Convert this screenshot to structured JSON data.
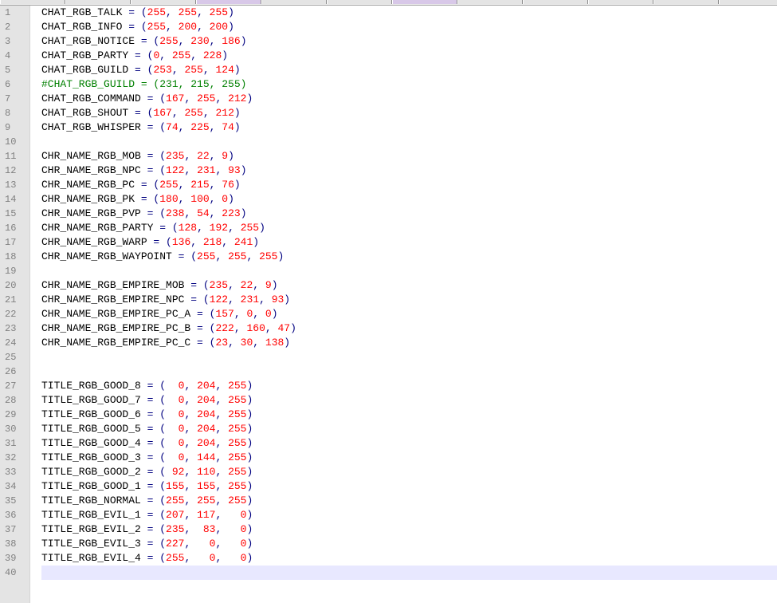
{
  "editor": {
    "colors": {
      "text": "#000000",
      "operator": "#000080",
      "number": "#ff0000",
      "comment": "#008000",
      "current_line": "#e8e8ff",
      "gutter": "#e4e4e4"
    },
    "current_line": 40,
    "lines": [
      {
        "n": "1",
        "kind": "assign",
        "name": "CHAT_RGB_TALK",
        "pad": "",
        "values": [
          "255",
          "255",
          "255"
        ]
      },
      {
        "n": "2",
        "kind": "assign",
        "name": "CHAT_RGB_INFO",
        "pad": "",
        "values": [
          "255",
          "200",
          "200"
        ]
      },
      {
        "n": "3",
        "kind": "assign",
        "name": "CHAT_RGB_NOTICE",
        "pad": "",
        "values": [
          "255",
          "230",
          "186"
        ]
      },
      {
        "n": "4",
        "kind": "assign",
        "name": "CHAT_RGB_PARTY",
        "pad": "",
        "values": [
          "0",
          "255",
          "228"
        ]
      },
      {
        "n": "5",
        "kind": "assign",
        "name": "CHAT_RGB_GUILD",
        "pad": "",
        "values": [
          "253",
          "255",
          "124"
        ]
      },
      {
        "n": "6",
        "kind": "comment",
        "text": "#CHAT_RGB_GUILD = (231, 215, 255)"
      },
      {
        "n": "7",
        "kind": "assign",
        "name": "CHAT_RGB_COMMAND",
        "pad": "",
        "values": [
          "167",
          "255",
          "212"
        ]
      },
      {
        "n": "8",
        "kind": "assign",
        "name": "CHAT_RGB_SHOUT",
        "pad": "",
        "values": [
          "167",
          "255",
          "212"
        ]
      },
      {
        "n": "9",
        "kind": "assign",
        "name": "CHAT_RGB_WHISPER",
        "pad": "",
        "values": [
          "74",
          "225",
          "74"
        ]
      },
      {
        "n": "10",
        "kind": "empty"
      },
      {
        "n": "11",
        "kind": "assign",
        "name": "CHR_NAME_RGB_MOB",
        "pad": "",
        "values": [
          "235",
          "22",
          "9"
        ]
      },
      {
        "n": "12",
        "kind": "assign",
        "name": "CHR_NAME_RGB_NPC",
        "pad": "",
        "values": [
          "122",
          "231",
          "93"
        ]
      },
      {
        "n": "13",
        "kind": "assign",
        "name": "CHR_NAME_RGB_PC",
        "pad": "",
        "values": [
          "255",
          "215",
          "76"
        ]
      },
      {
        "n": "14",
        "kind": "assign",
        "name": "CHR_NAME_RGB_PK",
        "pad": "",
        "values": [
          "180",
          "100",
          "0"
        ]
      },
      {
        "n": "15",
        "kind": "assign",
        "name": "CHR_NAME_RGB_PVP",
        "pad": "",
        "values": [
          "238",
          "54",
          "223"
        ]
      },
      {
        "n": "16",
        "kind": "assign",
        "name": "CHR_NAME_RGB_PARTY",
        "pad": "",
        "values": [
          "128",
          "192",
          "255"
        ]
      },
      {
        "n": "17",
        "kind": "assign",
        "name": "CHR_NAME_RGB_WARP",
        "pad": "",
        "values": [
          "136",
          "218",
          "241"
        ]
      },
      {
        "n": "18",
        "kind": "assign",
        "name": "CHR_NAME_RGB_WAYPOINT",
        "pad": "",
        "values": [
          "255",
          "255",
          "255"
        ]
      },
      {
        "n": "19",
        "kind": "empty"
      },
      {
        "n": "20",
        "kind": "assign",
        "name": "CHR_NAME_RGB_EMPIRE_MOB",
        "pad": "",
        "values": [
          "235",
          "22",
          "9"
        ]
      },
      {
        "n": "21",
        "kind": "assign",
        "name": "CHR_NAME_RGB_EMPIRE_NPC",
        "pad": "",
        "values": [
          "122",
          "231",
          "93"
        ]
      },
      {
        "n": "22",
        "kind": "assign",
        "name": "CHR_NAME_RGB_EMPIRE_PC_A",
        "pad": "",
        "values": [
          "157",
          "0",
          "0"
        ]
      },
      {
        "n": "23",
        "kind": "assign",
        "name": "CHR_NAME_RGB_EMPIRE_PC_B",
        "pad": "",
        "values": [
          "222",
          "160",
          "47"
        ]
      },
      {
        "n": "24",
        "kind": "assign",
        "name": "CHR_NAME_RGB_EMPIRE_PC_C",
        "pad": "",
        "values": [
          "23",
          "30",
          "138"
        ]
      },
      {
        "n": "25",
        "kind": "empty"
      },
      {
        "n": "26",
        "kind": "empty"
      },
      {
        "n": "27",
        "kind": "assign",
        "name": "TITLE_RGB_GOOD_8",
        "pad": "  ",
        "values": [
          "0",
          "204",
          "255"
        ]
      },
      {
        "n": "28",
        "kind": "assign",
        "name": "TITLE_RGB_GOOD_7",
        "pad": "  ",
        "values": [
          "0",
          "204",
          "255"
        ]
      },
      {
        "n": "29",
        "kind": "assign",
        "name": "TITLE_RGB_GOOD_6",
        "pad": "  ",
        "values": [
          "0",
          "204",
          "255"
        ]
      },
      {
        "n": "30",
        "kind": "assign",
        "name": "TITLE_RGB_GOOD_5",
        "pad": "  ",
        "values": [
          "0",
          "204",
          "255"
        ]
      },
      {
        "n": "31",
        "kind": "assign",
        "name": "TITLE_RGB_GOOD_4",
        "pad": "  ",
        "values": [
          "0",
          "204",
          "255"
        ]
      },
      {
        "n": "32",
        "kind": "assign",
        "name": "TITLE_RGB_GOOD_3",
        "pad": "  ",
        "values": [
          "0",
          "144",
          "255"
        ]
      },
      {
        "n": "33",
        "kind": "assign",
        "name": "TITLE_RGB_GOOD_2",
        "pad": " ",
        "values": [
          "92",
          "110",
          "255"
        ]
      },
      {
        "n": "34",
        "kind": "assign",
        "name": "TITLE_RGB_GOOD_1",
        "pad": "",
        "values": [
          "155",
          "155",
          "255"
        ]
      },
      {
        "n": "35",
        "kind": "assign",
        "name": "TITLE_RGB_NORMAL",
        "pad": "",
        "values": [
          "255",
          "255",
          "255"
        ]
      },
      {
        "n": "36",
        "kind": "assign",
        "name": "TITLE_RGB_EVIL_1",
        "pad": "",
        "values": [
          "207",
          "117",
          "  0"
        ]
      },
      {
        "n": "37",
        "kind": "assign",
        "name": "TITLE_RGB_EVIL_2",
        "pad": "",
        "values": [
          "235",
          " 83",
          "  0"
        ]
      },
      {
        "n": "38",
        "kind": "assign",
        "name": "TITLE_RGB_EVIL_3",
        "pad": "",
        "values": [
          "227",
          "  0",
          "  0"
        ]
      },
      {
        "n": "39",
        "kind": "assign",
        "name": "TITLE_RGB_EVIL_4",
        "pad": "",
        "values": [
          "255",
          "  0",
          "  0"
        ]
      },
      {
        "n": "40",
        "kind": "empty"
      }
    ]
  }
}
